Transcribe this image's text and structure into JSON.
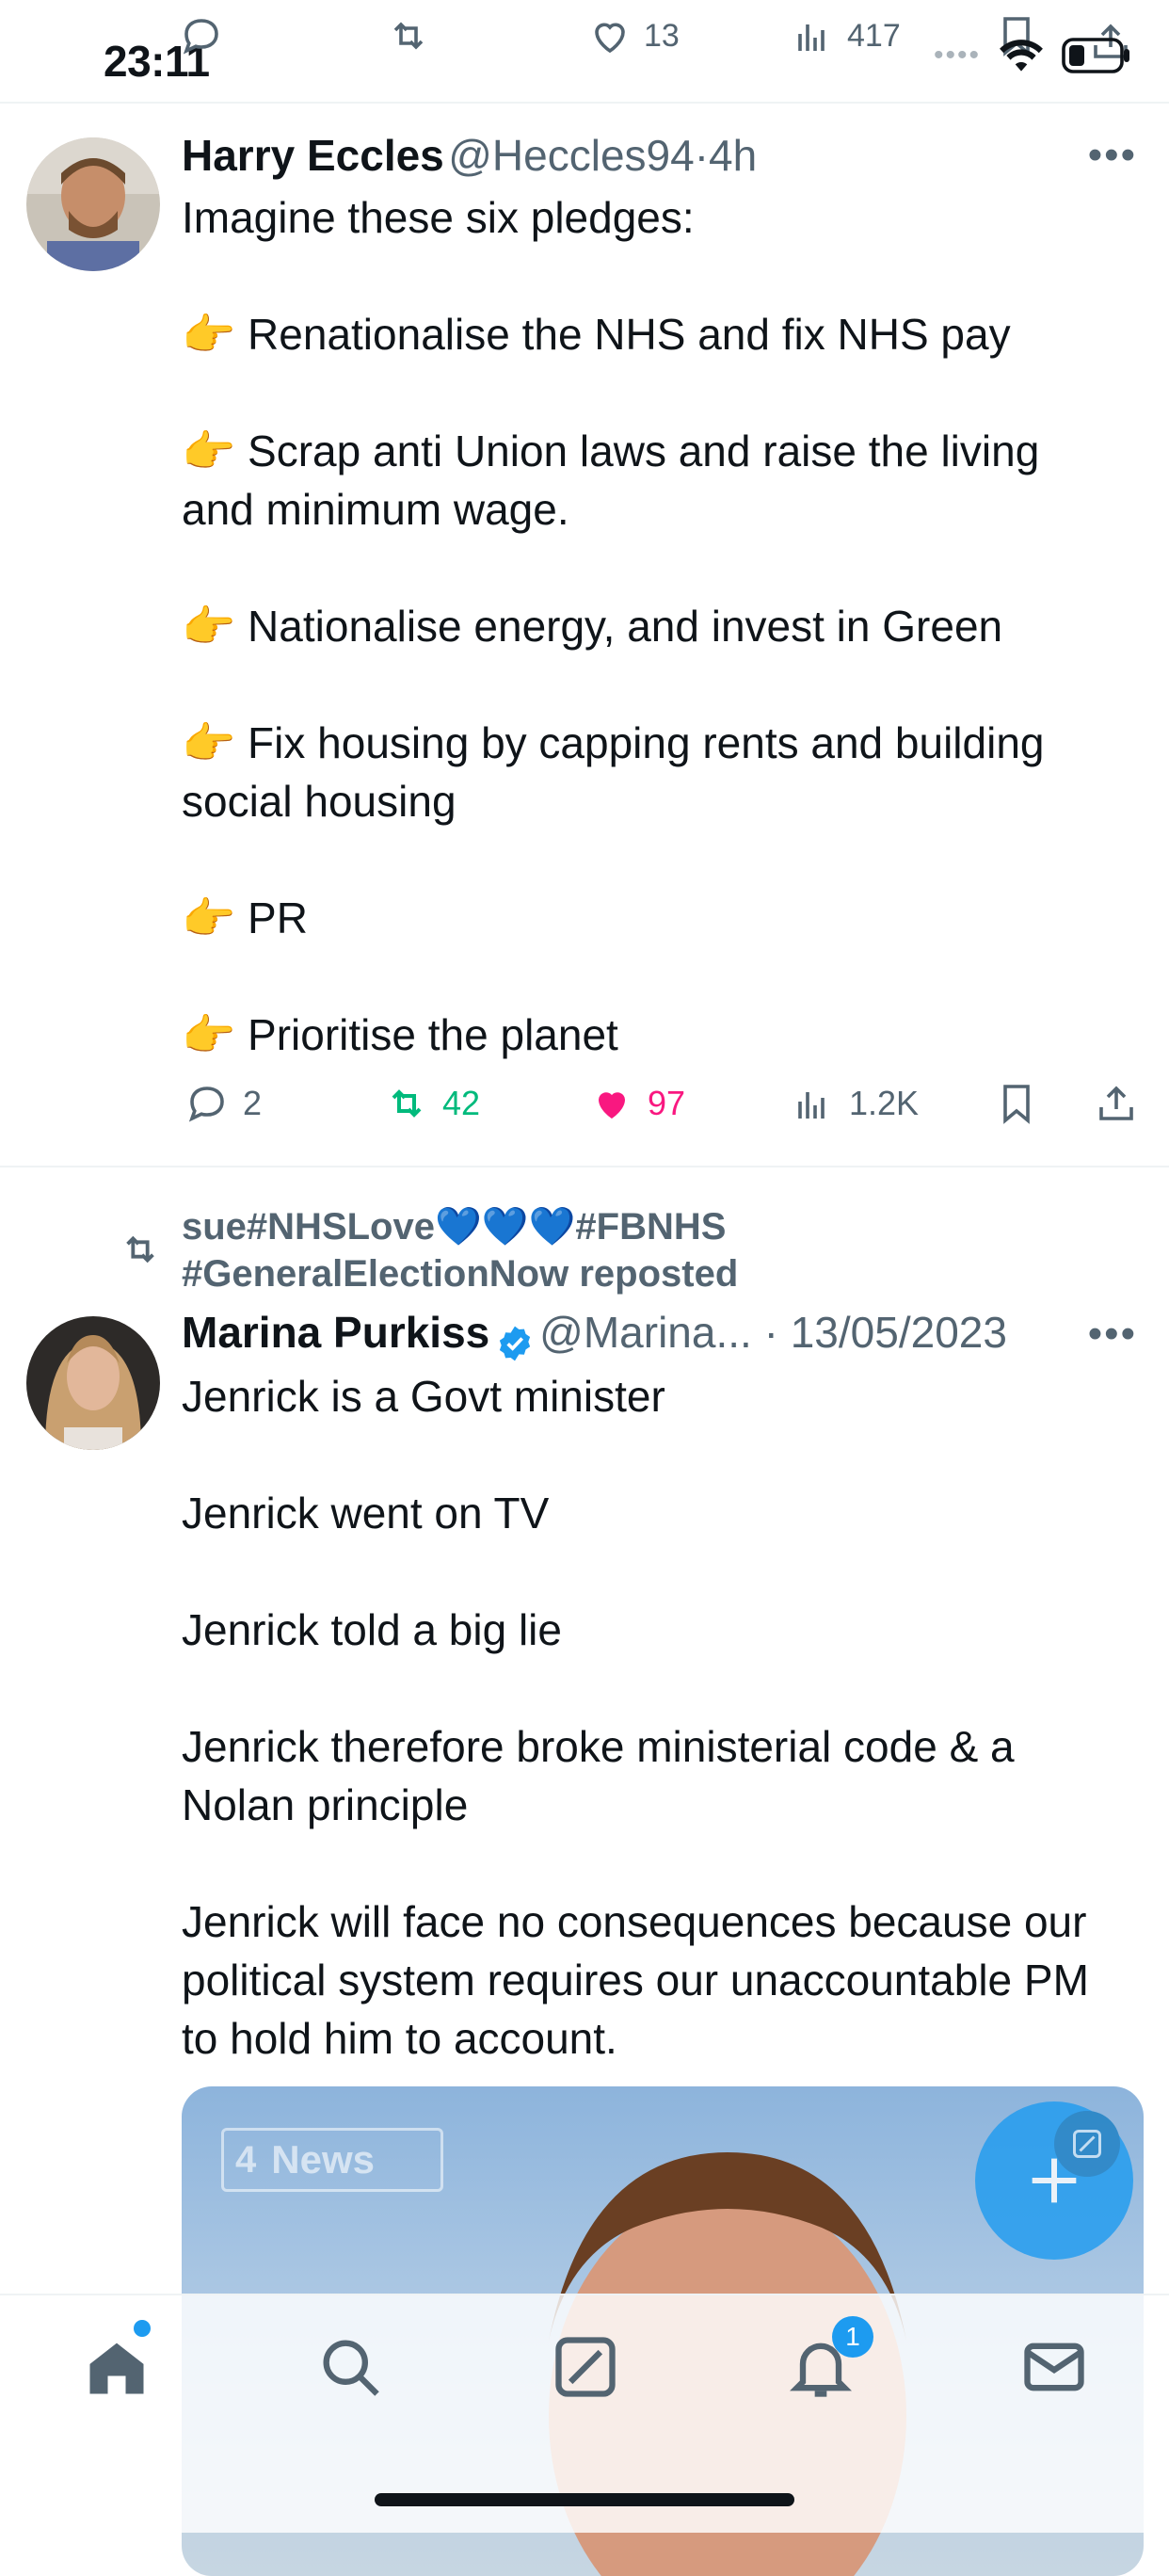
{
  "status_bar": {
    "time": "23:11"
  },
  "top_actions": {
    "likes": "13",
    "views": "417"
  },
  "tweet1": {
    "name": "Harry Eccles",
    "handle": "@Heccles94",
    "age": "4h",
    "text": "Imagine these six pledges:\n\n👉 Renationalise the NHS and fix NHS pay\n\n👉 Scrap anti Union laws and raise the living and minimum wage.\n\n👉 Nationalise energy, and invest in Green\n\n👉 Fix housing by capping rents and building social housing\n\n👉 PR\n\n👉 Prioritise the planet",
    "replies": "2",
    "reposts": "42",
    "likes": "97",
    "views": "1.2K",
    "colors": {
      "repost": "#00ba7c",
      "like": "#f91880"
    }
  },
  "tweet2": {
    "reposted_by": "sue#NHSLove💙💙💙#FBNHS",
    "reposted_by_line2": "#GeneralElectionNow reposted",
    "name": "Marina Purkiss",
    "handle": "@Marina...",
    "date": "13/05/2023",
    "text": "Jenrick is a Govt minister\n\nJenrick went on TV\n\nJenrick told a big lie\n\nJenrick therefore broke ministerial code & a Nolan principle\n\nJenrick will face no consequences because our political system requires our unaccountable PM to hold him to account.",
    "media_watermark": "News"
  },
  "tab_bar": {
    "icons": [
      "home-icon",
      "search-icon",
      "grok-icon",
      "bell-icon",
      "mail-icon"
    ],
    "notification_badge": "1"
  },
  "accent_color": "#1d9bf0"
}
